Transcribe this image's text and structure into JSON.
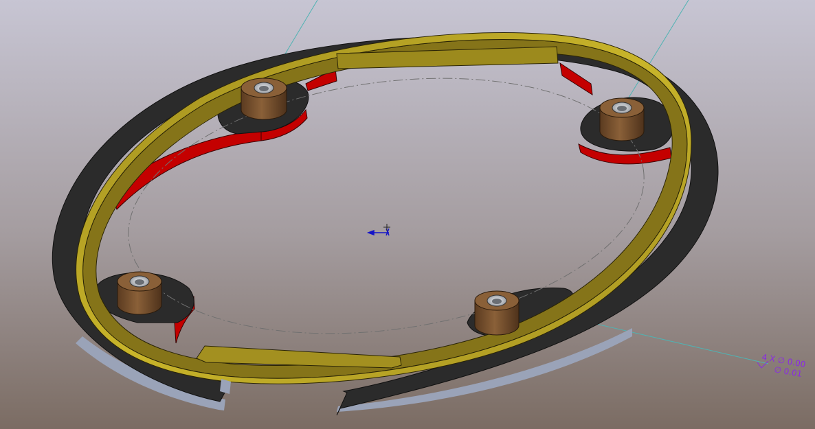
{
  "viewport": {
    "background_top": "#c7c5d3",
    "background_bottom": "#7b6c63"
  },
  "part": {
    "ring_color": "#857419",
    "ring_light": "#c9b52a",
    "plate_color": "#2b2b2b",
    "cutout_color": "#c40000",
    "boss_color": "#7a5331",
    "hole_color": "#c8ccd2",
    "boss_count": 4
  },
  "annotations": {
    "color": "#8a2be2",
    "hole_callout_line1": "4 X ∅ 0.00",
    "hole_callout_line2": "∅ 0.01"
  },
  "triad": {
    "color": "#1414c8"
  }
}
